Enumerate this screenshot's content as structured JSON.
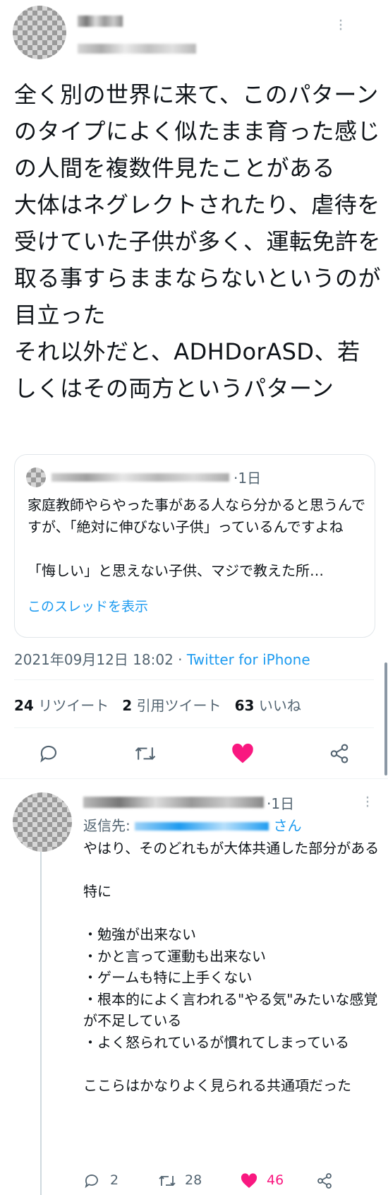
{
  "tweet": {
    "body": "全く別の世界に来て、このパターンのタイプによく似たまま育った感じの人間を複数件見たことがある\n大体はネグレクトされたり、虐待を受けていた子供が多く、運転免許を取る事すらままならないというのが目立った\nそれ以外だと、ADHDorASD、若しくはその両方というパターン",
    "timestamp": "2021年09月12日 18:02",
    "separator": "·",
    "client": "Twitter for iPhone",
    "stats": {
      "retweets_count": "24",
      "retweets_label": "リツイート",
      "quotes_count": "2",
      "quotes_label": "引用ツイート",
      "likes_count": "63",
      "likes_label": "いいね"
    }
  },
  "quoted": {
    "time": "·1日",
    "body": "家庭教師やらやった事がある人なら分かると思うんですが、「絶対に伸びない子供」っているんですよね\n\n「悔しい」と思えない子供、マジで教えた所…",
    "show_thread": "このスレッドを表示"
  },
  "reply": {
    "time": "·1日",
    "reply_prefix": "返信先: ",
    "reply_suffix": "さん",
    "body": "やはり、そのどれもが大体共通した部分がある\n\n特に\n\n・勉強が出来ない\n・かと言って運動も出来ない\n・ゲームも特に上手くない\n・根本的によく言われる\"やる気\"みたいな感覚が不足している\n・よく怒られているが慣れてしまっている\n\nここらはかなりよく見られる共通項だった",
    "reply_count": "2",
    "retweet_count": "28",
    "like_count": "46"
  },
  "colors": {
    "accent": "#1d9bf0",
    "like": "#f91880",
    "muted": "#536471"
  },
  "icons": [
    "more-icon",
    "reply-icon",
    "retweet-icon",
    "heart-icon",
    "share-icon"
  ]
}
